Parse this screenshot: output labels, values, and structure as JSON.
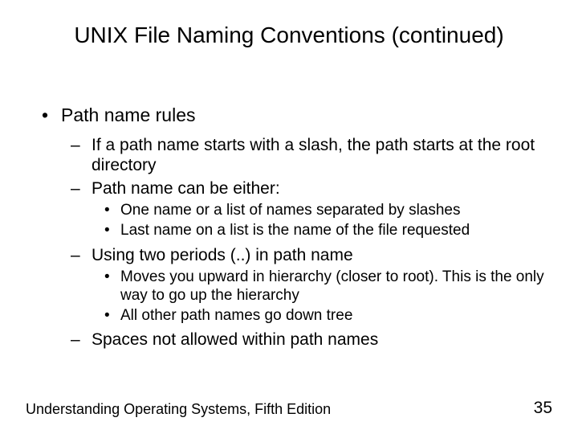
{
  "title": "UNIX File Naming Conventions (continued)",
  "bullets": {
    "l1_0": "Path name rules",
    "l2_0": "If a path name starts with a slash, the path starts at the root directory",
    "l2_1": "Path name can be either:",
    "l3_0": "One name or a list of names separated by slashes",
    "l3_1": "Last name on a list is the name of the file requested",
    "l2_2": "Using two periods (..) in path name",
    "l3_2": "Moves you upward in hierarchy (closer to root). This is the only way to go up the hierarchy",
    "l3_3": "All other path names go down tree",
    "l2_3": "Spaces not allowed within path names"
  },
  "footer": {
    "source": "Understanding Operating Systems, Fifth Edition",
    "page": "35"
  }
}
